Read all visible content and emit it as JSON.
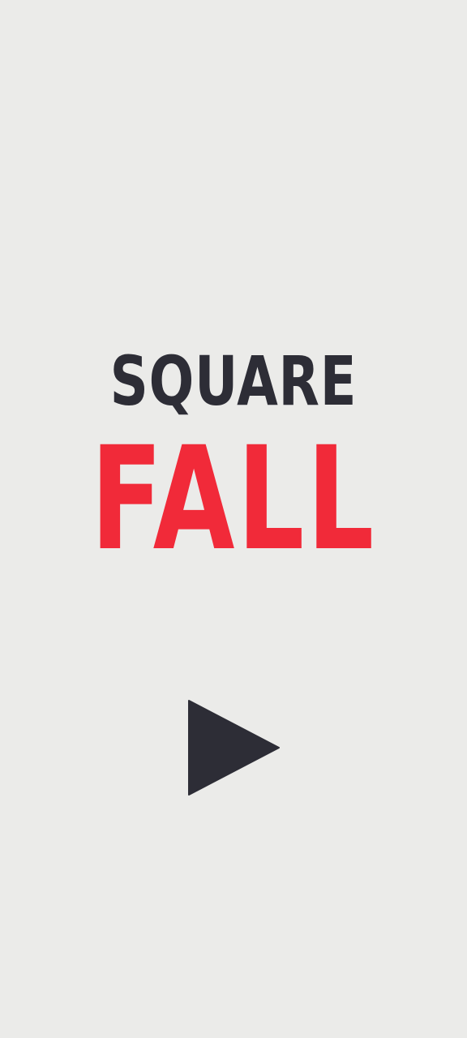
{
  "title": {
    "line1": "SQUARE",
    "line2": "FALL"
  },
  "colors": {
    "background": "#ebebe9",
    "dark": "#2d2d36",
    "accent": "#f12a39"
  },
  "controls": {
    "play_icon": "play-icon"
  }
}
